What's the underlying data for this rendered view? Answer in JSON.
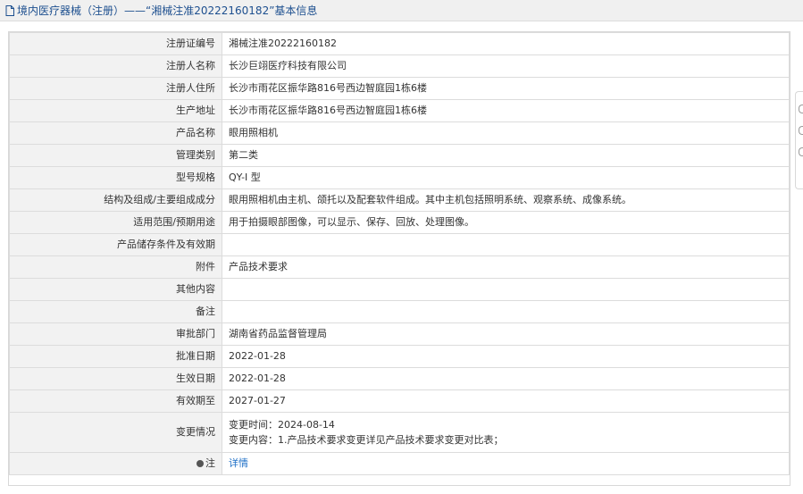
{
  "header": {
    "title": "境内医疗器械（注册）——“湘械注准20222160182”基本信息",
    "icon": "document-icon"
  },
  "rows": [
    {
      "key": "注册证编号",
      "value": "湘械注准20222160182"
    },
    {
      "key": "注册人名称",
      "value": "长沙巨翊医疗科技有限公司"
    },
    {
      "key": "注册人住所",
      "value": "长沙市雨花区振华路816号西边智庭园1栋6楼"
    },
    {
      "key": "生产地址",
      "value": "长沙市雨花区振华路816号西边智庭园1栋6楼"
    },
    {
      "key": "产品名称",
      "value": "眼用照相机"
    },
    {
      "key": "管理类别",
      "value": "第二类"
    },
    {
      "key": "型号规格",
      "value": "QY-I 型"
    },
    {
      "key": "结构及组成/主要组成成分",
      "value": "眼用照相机由主机、颌托以及配套软件组成。其中主机包括照明系统、观察系统、成像系统。"
    },
    {
      "key": "适用范围/预期用途",
      "value": "用于拍摄眼部图像，可以显示、保存、回放、处理图像。"
    },
    {
      "key": "产品储存条件及有效期",
      "value": ""
    },
    {
      "key": "附件",
      "value": "产品技术要求"
    },
    {
      "key": "其他内容",
      "value": ""
    },
    {
      "key": "备注",
      "value": ""
    },
    {
      "key": "审批部门",
      "value": "湖南省药品监督管理局"
    },
    {
      "key": "批准日期",
      "value": "2022-01-28"
    },
    {
      "key": "生效日期",
      "value": "2022-01-28"
    },
    {
      "key": "有效期至",
      "value": "2027-01-27"
    }
  ],
  "change": {
    "key": "变更情况",
    "time": "变更时间：2024-08-14",
    "content": "变更内容：1.产品技术要求变更详见产品技术要求变更对比表；"
  },
  "note": {
    "key": "注",
    "link": "详情",
    "icon": "pin-icon"
  },
  "side_tab_icons": [
    "side-tab-icon-1",
    "side-tab-icon-2",
    "side-tab-icon-3"
  ]
}
